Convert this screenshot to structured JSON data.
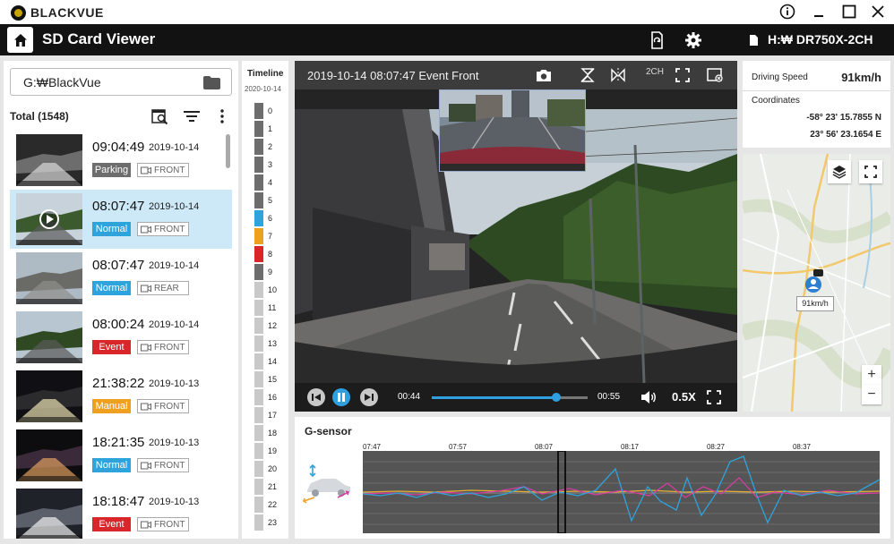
{
  "window": {
    "brand": "BLACKVUE",
    "controls": [
      "info-icon",
      "minimize-icon",
      "maximize-icon",
      "close-icon"
    ]
  },
  "header": {
    "title": "SD Card Viewer",
    "device": "H:₩ DR750X-2CH"
  },
  "files": {
    "path": "G:₩BlackVue",
    "total": "Total (1548)",
    "items": [
      {
        "time": "09:04:49",
        "date": "2019-10-14",
        "type": "Parking",
        "type_color": "#6d6d6d",
        "camera": "FRONT",
        "selected": false
      },
      {
        "time": "08:07:47",
        "date": "2019-10-14",
        "type": "Normal",
        "type_color": "#2ea3dc",
        "camera": "FRONT",
        "selected": true
      },
      {
        "time": "08:07:47",
        "date": "2019-10-14",
        "type": "Normal",
        "type_color": "#2ea3dc",
        "camera": "REAR",
        "selected": false
      },
      {
        "time": "08:00:24",
        "date": "2019-10-14",
        "type": "Event",
        "type_color": "#d9262b",
        "camera": "FRONT",
        "selected": false
      },
      {
        "time": "21:38:22",
        "date": "2019-10-13",
        "type": "Manual",
        "type_color": "#f0a020",
        "camera": "FRONT",
        "selected": false
      },
      {
        "time": "18:21:35",
        "date": "2019-10-13",
        "type": "Normal",
        "type_color": "#2ea3dc",
        "camera": "FRONT",
        "selected": false
      },
      {
        "time": "18:18:47",
        "date": "2019-10-13",
        "type": "Event",
        "type_color": "#d9262b",
        "camera": "FRONT",
        "selected": false
      }
    ]
  },
  "timeline": {
    "title": "Timeline",
    "date": "2020-10-14",
    "hours": [
      {
        "label": "0",
        "color": "#6d6d6d"
      },
      {
        "label": "1",
        "color": "#6d6d6d"
      },
      {
        "label": "2",
        "color": "#6d6d6d"
      },
      {
        "label": "3",
        "color": "#6d6d6d"
      },
      {
        "label": "4",
        "color": "#6d6d6d"
      },
      {
        "label": "5",
        "color": "#6d6d6d"
      },
      {
        "label": "6",
        "color": "#2ea3dc"
      },
      {
        "label": "7",
        "color": "#f0a020"
      },
      {
        "label": "8",
        "color": "#d9262b"
      },
      {
        "label": "9",
        "color": "#6d6d6d"
      },
      {
        "label": "10",
        "color": "#c9c9c9"
      },
      {
        "label": "11",
        "color": "#c9c9c9"
      },
      {
        "label": "12",
        "color": "#c9c9c9"
      },
      {
        "label": "13",
        "color": "#c9c9c9"
      },
      {
        "label": "14",
        "color": "#c9c9c9"
      },
      {
        "label": "15",
        "color": "#c9c9c9"
      },
      {
        "label": "16",
        "color": "#c9c9c9"
      },
      {
        "label": "17",
        "color": "#c9c9c9"
      },
      {
        "label": "18",
        "color": "#c9c9c9"
      },
      {
        "label": "19",
        "color": "#c9c9c9"
      },
      {
        "label": "20",
        "color": "#c9c9c9"
      },
      {
        "label": "21",
        "color": "#c9c9c9"
      },
      {
        "label": "22",
        "color": "#c9c9c9"
      },
      {
        "label": "23",
        "color": "#c9c9c9"
      }
    ]
  },
  "video": {
    "title": "2019-10-14 08:07:47 Event Front",
    "channel": "2CH",
    "current_time": "00:44",
    "end_time": "00:55",
    "progress": 0.8,
    "speed": "0.5X"
  },
  "info": {
    "speed_label": "Driving Speed",
    "speed_value": "91km/h",
    "coord_label": "Coordinates",
    "latitude": "-58° 23'  15.7855 N",
    "longitude": "23° 56'  23.1654 E"
  },
  "map": {
    "speed_tag": "91km/h",
    "zoom_in": "+",
    "zoom_out": "−"
  },
  "gsensor": {
    "title": "G-sensor",
    "ticks": [
      "07:47",
      "07:57",
      "08:07",
      "08:17",
      "08:27",
      "08:37"
    ]
  }
}
